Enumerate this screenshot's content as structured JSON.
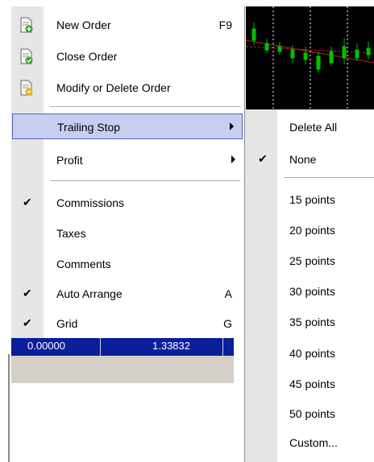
{
  "menu": {
    "items": [
      {
        "label": "New Order",
        "shortcut": "F9",
        "icon": "new-order-icon"
      },
      {
        "label": "Close Order",
        "icon": "close-order-icon"
      },
      {
        "label": "Modify or Delete Order",
        "icon": "modify-order-icon"
      },
      {
        "label": "Trailing Stop",
        "submenu": true,
        "highlighted": true
      },
      {
        "label": "Profit",
        "submenu": true
      },
      {
        "label": "Commissions",
        "checked": true
      },
      {
        "label": "Taxes"
      },
      {
        "label": "Comments"
      },
      {
        "label": "Auto Arrange",
        "shortcut": "A",
        "checked": true
      },
      {
        "label": "Grid",
        "shortcut": "G",
        "checked": true
      }
    ]
  },
  "submenu": {
    "items": [
      {
        "label": "Delete All"
      },
      {
        "label": "None",
        "checked": true
      },
      {
        "label": "15 points"
      },
      {
        "label": "20 points"
      },
      {
        "label": "25 points"
      },
      {
        "label": "30 points"
      },
      {
        "label": "35 points"
      },
      {
        "label": "40 points"
      },
      {
        "label": "45 points"
      },
      {
        "label": "50 points"
      },
      {
        "label": "Custom..."
      }
    ]
  },
  "check_glyph": "✔",
  "background_table": {
    "cell1": "0.00000",
    "cell2": "1.33832"
  },
  "colors": {
    "highlight": "#c6cff2",
    "highlight_border": "#5363b5",
    "table_row": "#0b1f9c",
    "chart_bg": "#000000"
  }
}
